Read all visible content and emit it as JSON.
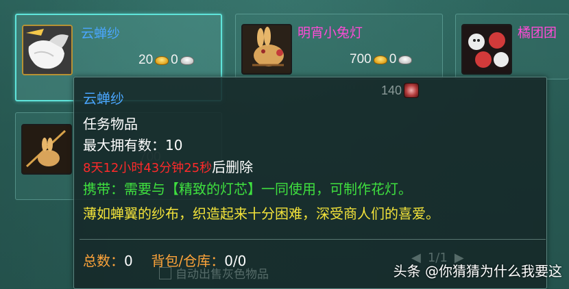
{
  "items": [
    {
      "name": "云蝉纱",
      "price_gold": "20",
      "price_silver": "0",
      "icon": "white-gauze-cloth-icon",
      "name_color": "#4aa6ff",
      "selected": true
    },
    {
      "name": "明宵小兔灯",
      "price_gold": "700",
      "price_silver": "0",
      "icon": "rabbit-lantern-icon",
      "name_color": "#ff4bd7"
    },
    {
      "name": "橘团团",
      "icon": "red-white-lanterns-icon",
      "name_color": "#ff4bd7"
    },
    {
      "icon": "rabbit-lantern-stick-icon",
      "price_gold": "700"
    }
  ],
  "hidden_price_fragment": "140",
  "tooltip": {
    "title": "云蝉纱",
    "category": "任务物品",
    "max_owned_label": "最大拥有数：",
    "max_owned_value": "10",
    "expire_time": "8天12小时43分钟25秒",
    "expire_suffix": "后删除",
    "carry_text": "携带：需要与【精致的灯芯】一同使用，可制作花灯。",
    "description": "薄如蝉翼的纱布，织造起来十分困难，深受商人们的喜爱。",
    "total_label": "总数：",
    "total_value": "0",
    "bag_label": "背包/仓库：",
    "bag_value": "0/0",
    "colors": {
      "title": "#4aa6ff",
      "normal": "#ffffff",
      "expire": "#ff2a2a",
      "carry": "#3fe03f",
      "description": "#f3e33a",
      "summary_label": "#ffa43a"
    }
  },
  "behind_controls": {
    "page_indicator": "1/1",
    "auto_sell_label": "自动出售灰色物品"
  },
  "watermark": "头条 @你猜猜为什么我要这"
}
